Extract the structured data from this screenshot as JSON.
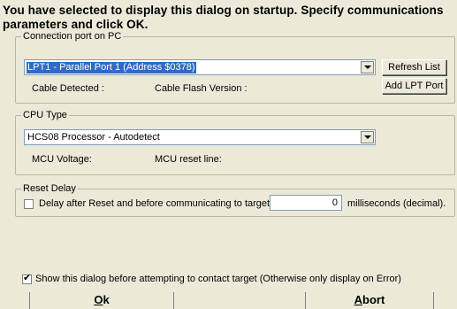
{
  "heading": "You have selected to display this dialog on startup. Specify communications parameters and click OK.",
  "connection": {
    "group_title": "Connection port on PC",
    "port_value": "LPT1 - Parallel Port 1 (Address $0378)",
    "refresh_label": "Refresh List",
    "add_lpt_label": "Add LPT Port",
    "cable_detected_label": "Cable Detected :",
    "cable_flash_label": "Cable Flash Version :"
  },
  "cpu": {
    "group_title": "CPU Type",
    "cpu_value": "HCS08 Processor - Autodetect",
    "mcu_voltage_label": "MCU Voltage:",
    "mcu_reset_label": "MCU reset line:"
  },
  "reset": {
    "group_title": "Reset Delay",
    "checkbox_label": "Delay after Reset and before communicating to target for",
    "delay_value": "0",
    "units_label": "milliseconds (decimal)."
  },
  "show_dialog": {
    "checked": true,
    "label": "Show this dialog before attempting to contact target (Otherwise only display on Error)"
  },
  "buttons": {
    "ok_accel": "O",
    "ok_rest": "k",
    "abort_accel": "A",
    "abort_rest": "bort"
  }
}
